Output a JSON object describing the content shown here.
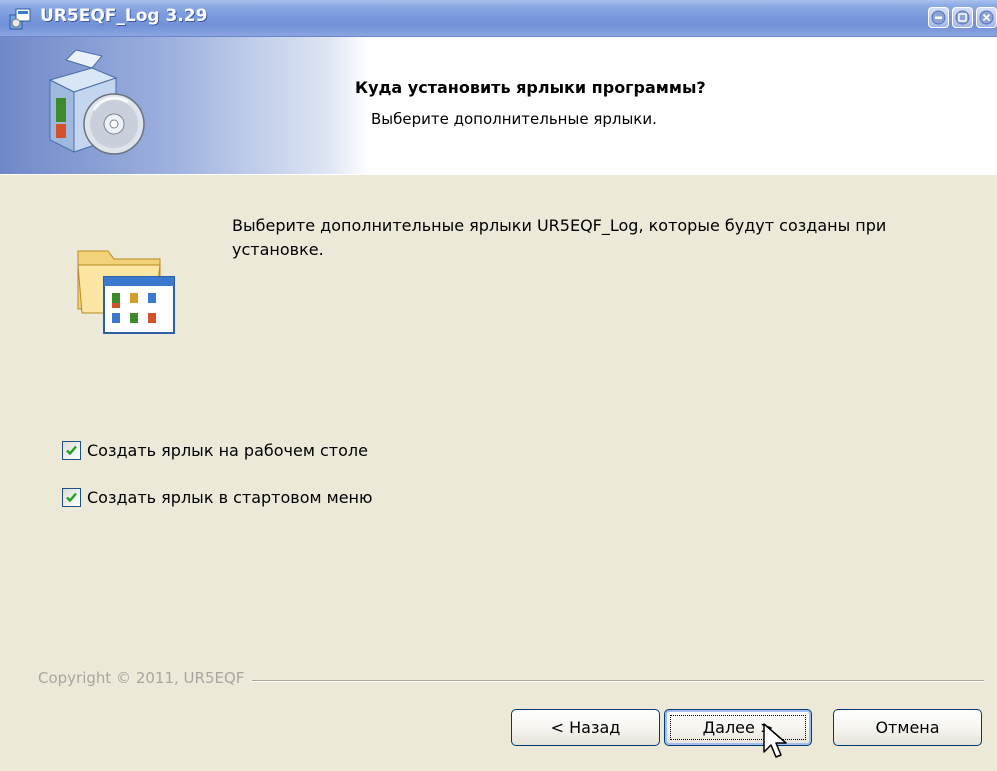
{
  "window": {
    "title": "UR5EQF_Log 3.29",
    "controls": [
      "minimize-icon",
      "maximize-icon",
      "close-icon"
    ]
  },
  "banner": {
    "title": "Куда установить ярлыки программы?",
    "subtitle": "Выберите дополнительные ярлыки.",
    "icon": "setup-disc-icon"
  },
  "main": {
    "icon": "shortcuts-folder-icon",
    "description": "Выберите дополнительные ярлыки UR5EQF_Log, которые будут созданы при установке.",
    "options": [
      {
        "label": "Создать ярлык на рабочем столе",
        "checked": true
      },
      {
        "label": "Создать ярлык в стартовом меню",
        "checked": true
      }
    ]
  },
  "footer": {
    "copyright": "Copyright © 2011, UR5EQF",
    "buttons": {
      "back": "< Назад",
      "next": "Далее >",
      "cancel": "Отмена"
    }
  },
  "colors": {
    "titlebar": "#7b9bdd",
    "dialog_bg": "#ece9d8",
    "button_border": "#003c74",
    "checkmark": "#21a121"
  }
}
